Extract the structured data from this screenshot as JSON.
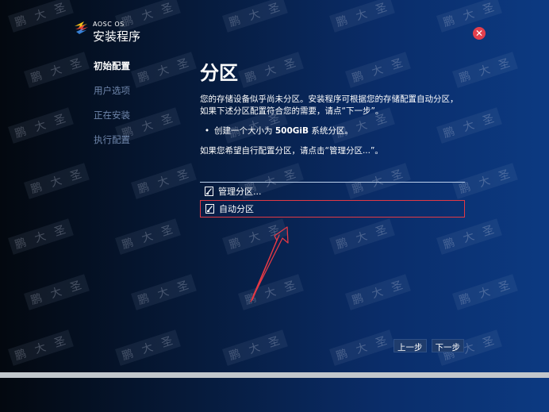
{
  "header": {
    "distro_name": "AOSC OS",
    "app_title": "安装程序"
  },
  "steps": [
    {
      "label": "初始配置",
      "active": true
    },
    {
      "label": "用户选项",
      "active": false
    },
    {
      "label": "正在安装",
      "active": false
    },
    {
      "label": "执行配置",
      "active": false
    }
  ],
  "main": {
    "title": "分区",
    "description_line1": "您的存储设备似乎尚未分区。安装程序可根据您的存储配置自动分区，",
    "description_line2": "如果下述分区配置符合您的需要，请点“下一步”。",
    "bullet_prefix": "创建一个大小为 ",
    "bullet_size": "500GiB",
    "bullet_suffix": " 系统分区。",
    "manual_prompt": "如果您希望自行配置分区，请点击“管理分区...”。"
  },
  "options": [
    {
      "label": "管理分区...",
      "selected": false
    },
    {
      "label": "自动分区",
      "selected": true
    }
  ],
  "nav": {
    "back_label": "上一步",
    "next_label": "下一步"
  },
  "watermark": {
    "text_chars": [
      "鹏",
      "大",
      "圣"
    ]
  },
  "progress": {
    "fraction": 1.0
  },
  "colors": {
    "accent_red": "#e23945",
    "close_red": "#e23f4d",
    "inactive_step": "#6f86ab"
  }
}
